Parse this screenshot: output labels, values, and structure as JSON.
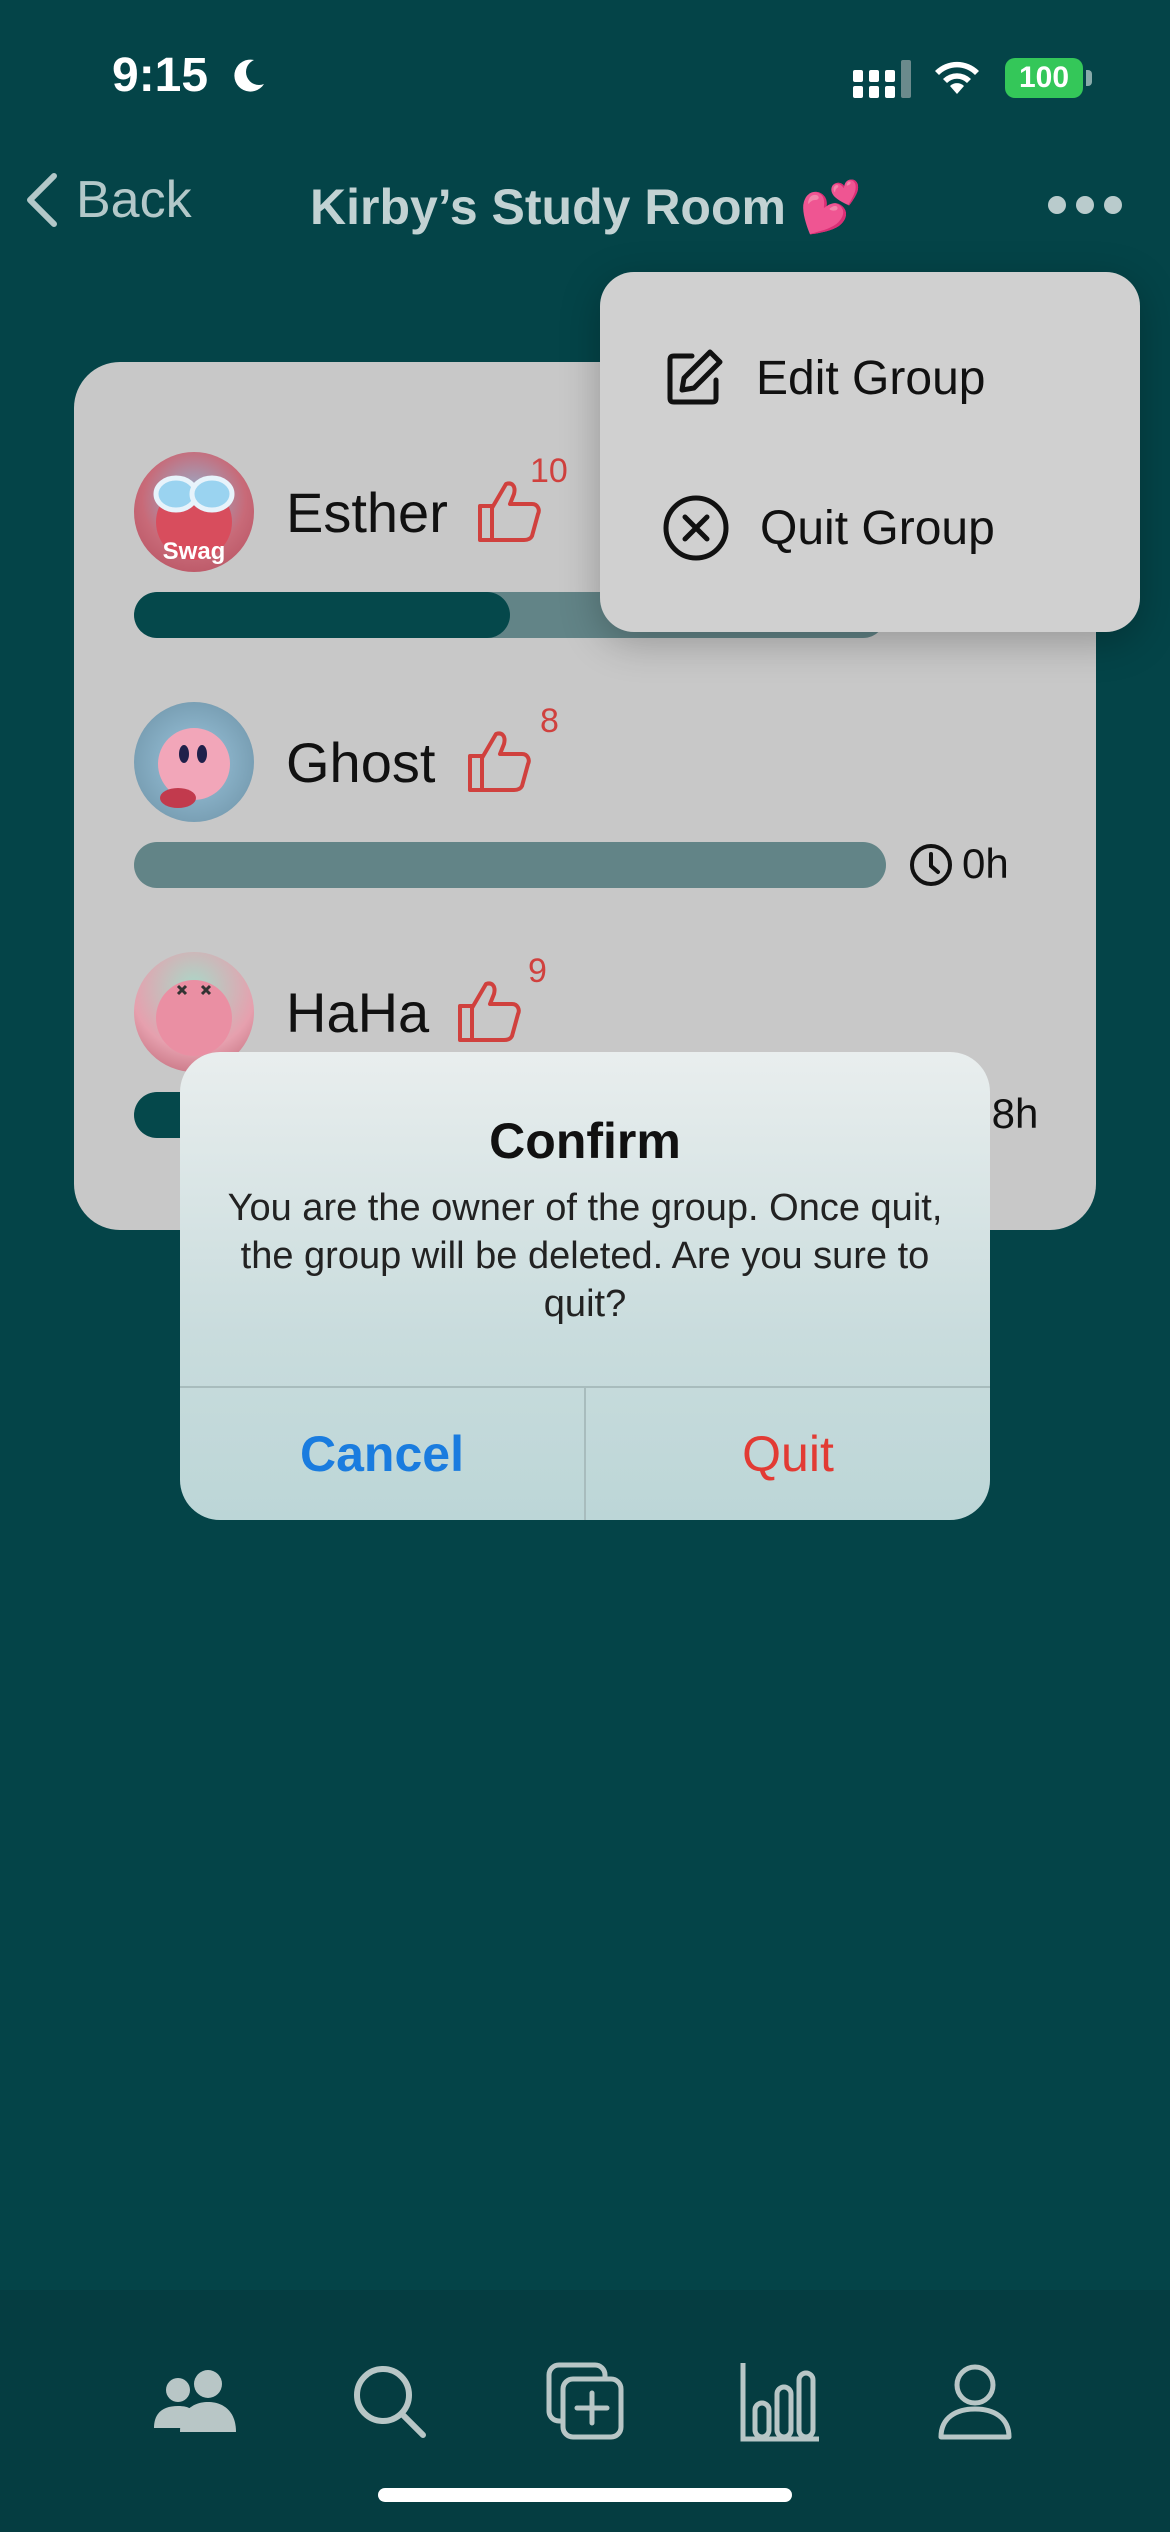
{
  "status_bar": {
    "time": "9:15",
    "battery": "100"
  },
  "nav": {
    "back_label": "Back",
    "title": "Kirby’s Study Room 💕"
  },
  "members": [
    {
      "name": "Esther",
      "likes": "10",
      "hours": "",
      "progress": 0.5,
      "avatar_label": "Swag"
    },
    {
      "name": "Ghost",
      "likes": "8",
      "hours": "0h",
      "progress": 0.0
    },
    {
      "name": "HaHa",
      "likes": "9",
      "hours": ".8h",
      "progress": 0.1
    }
  ],
  "menu": {
    "edit_label": "Edit Group",
    "quit_label": "Quit Group"
  },
  "alert": {
    "title": "Confirm",
    "message": "You are the owner of the group. Once quit, the group will be deleted. Are you sure to quit?",
    "cancel_label": "Cancel",
    "quit_label": "Quit"
  },
  "tabs": [
    "people-icon",
    "search-icon",
    "add-icon",
    "stats-icon",
    "profile-icon"
  ],
  "colors": {
    "background": "#044448",
    "accent_red": "#d0413e",
    "link_blue": "#1a7cdf"
  }
}
